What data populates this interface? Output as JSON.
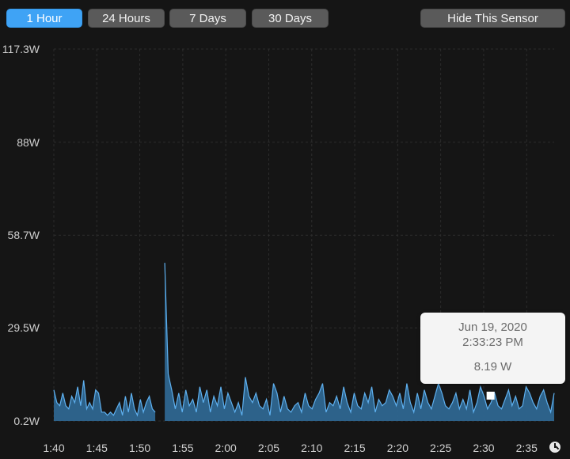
{
  "range_buttons": [
    {
      "label": "1 Hour",
      "active": true
    },
    {
      "label": "24 Hours",
      "active": false
    },
    {
      "label": "7 Days",
      "active": false
    },
    {
      "label": "30 Days",
      "active": false
    }
  ],
  "hide_button": {
    "label": "Hide This Sensor"
  },
  "tooltip": {
    "date": "Jun 19, 2020",
    "time": "2:33:23 PM",
    "value": "8.19 W"
  },
  "colors": {
    "accent": "#3fa3f5",
    "fill": "#2e6690",
    "line": "#5eb0ef",
    "grid": "#2c2c2c",
    "background": "#151515"
  },
  "icons": {
    "history": "clock-icon"
  },
  "chart_data": {
    "type": "area",
    "y_ticks": [
      "117.3W",
      "88W",
      "58.7W",
      "29.5W",
      "0.2W"
    ],
    "y_tick_values": [
      117.3,
      88,
      58.7,
      29.5,
      0.2
    ],
    "x_ticks": [
      "1:40",
      "1:45",
      "1:50",
      "1:55",
      "2:00",
      "2:05",
      "2:10",
      "2:15",
      "2:20",
      "2:25",
      "2:30",
      "2:35"
    ],
    "x_tick_minutes": [
      0,
      5,
      10,
      15,
      20,
      25,
      30,
      35,
      40,
      45,
      50,
      55
    ],
    "ylim": [
      0.2,
      117.3
    ],
    "xlim_minutes": [
      0,
      58.2
    ],
    "grid": true,
    "gap_minutes": [
      11.8,
      12.8
    ],
    "spike": {
      "minute": 12.9,
      "value": 50
    },
    "highlight": {
      "minute": 50.8,
      "value": 8.19
    },
    "values": [
      10,
      6,
      5,
      9,
      5,
      4,
      8,
      6,
      11,
      5,
      13,
      4,
      6,
      4,
      10,
      9,
      3,
      3,
      2,
      3,
      2,
      4,
      6,
      2,
      8,
      3,
      9,
      4,
      2,
      7,
      3,
      6,
      8,
      4,
      3,
      50,
      15,
      10,
      4,
      9,
      3,
      10,
      5,
      7,
      3,
      11,
      6,
      10,
      3,
      8,
      5,
      11,
      4,
      9,
      6,
      3,
      6,
      2,
      14,
      8,
      6,
      9,
      5,
      4,
      7,
      2,
      12,
      9,
      3,
      8,
      4,
      3,
      5,
      6,
      3,
      9,
      5,
      4,
      7,
      9,
      12,
      3,
      6,
      5,
      8,
      4,
      11,
      6,
      3,
      9,
      5,
      4,
      9,
      6,
      11,
      3,
      7,
      5,
      6,
      10,
      8,
      5,
      9,
      4,
      12,
      6,
      3,
      9,
      4,
      10,
      6,
      4,
      8,
      12,
      9,
      5,
      4,
      6,
      9,
      4,
      7,
      4,
      10,
      3,
      6,
      11,
      8,
      4,
      6,
      9,
      5,
      4,
      7,
      10,
      5,
      8,
      4,
      5,
      11,
      9,
      6,
      4,
      8,
      10,
      6,
      3,
      9
    ]
  }
}
